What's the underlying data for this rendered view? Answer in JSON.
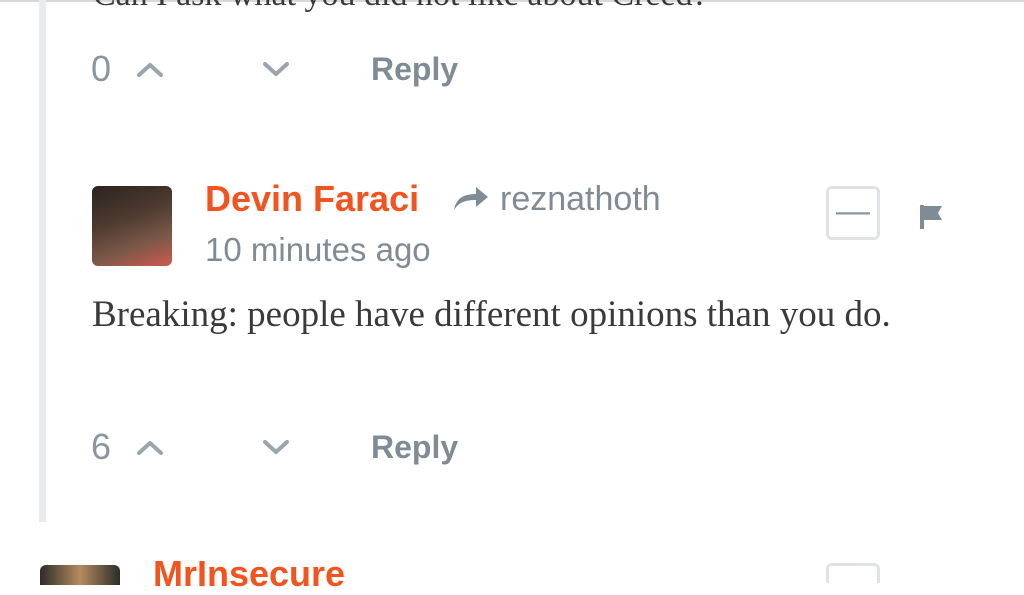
{
  "previous_comment": {
    "cut_off_text": "Can I ask what you did not like about Creed?",
    "vote_count": "0",
    "reply_label": "Reply"
  },
  "comment": {
    "author": "Devin Faraci",
    "in_reply_to": "reznathoth",
    "timestamp": "10 minutes ago",
    "body": "Breaking: people have different opinions than you do.",
    "vote_count": "6",
    "reply_label": "Reply",
    "collapse_label": "—"
  },
  "next_comment": {
    "author": "MrInsecure"
  },
  "colors": {
    "author": "#f2541f",
    "muted": "#7f8c96",
    "thread_line": "#e9ecee"
  }
}
